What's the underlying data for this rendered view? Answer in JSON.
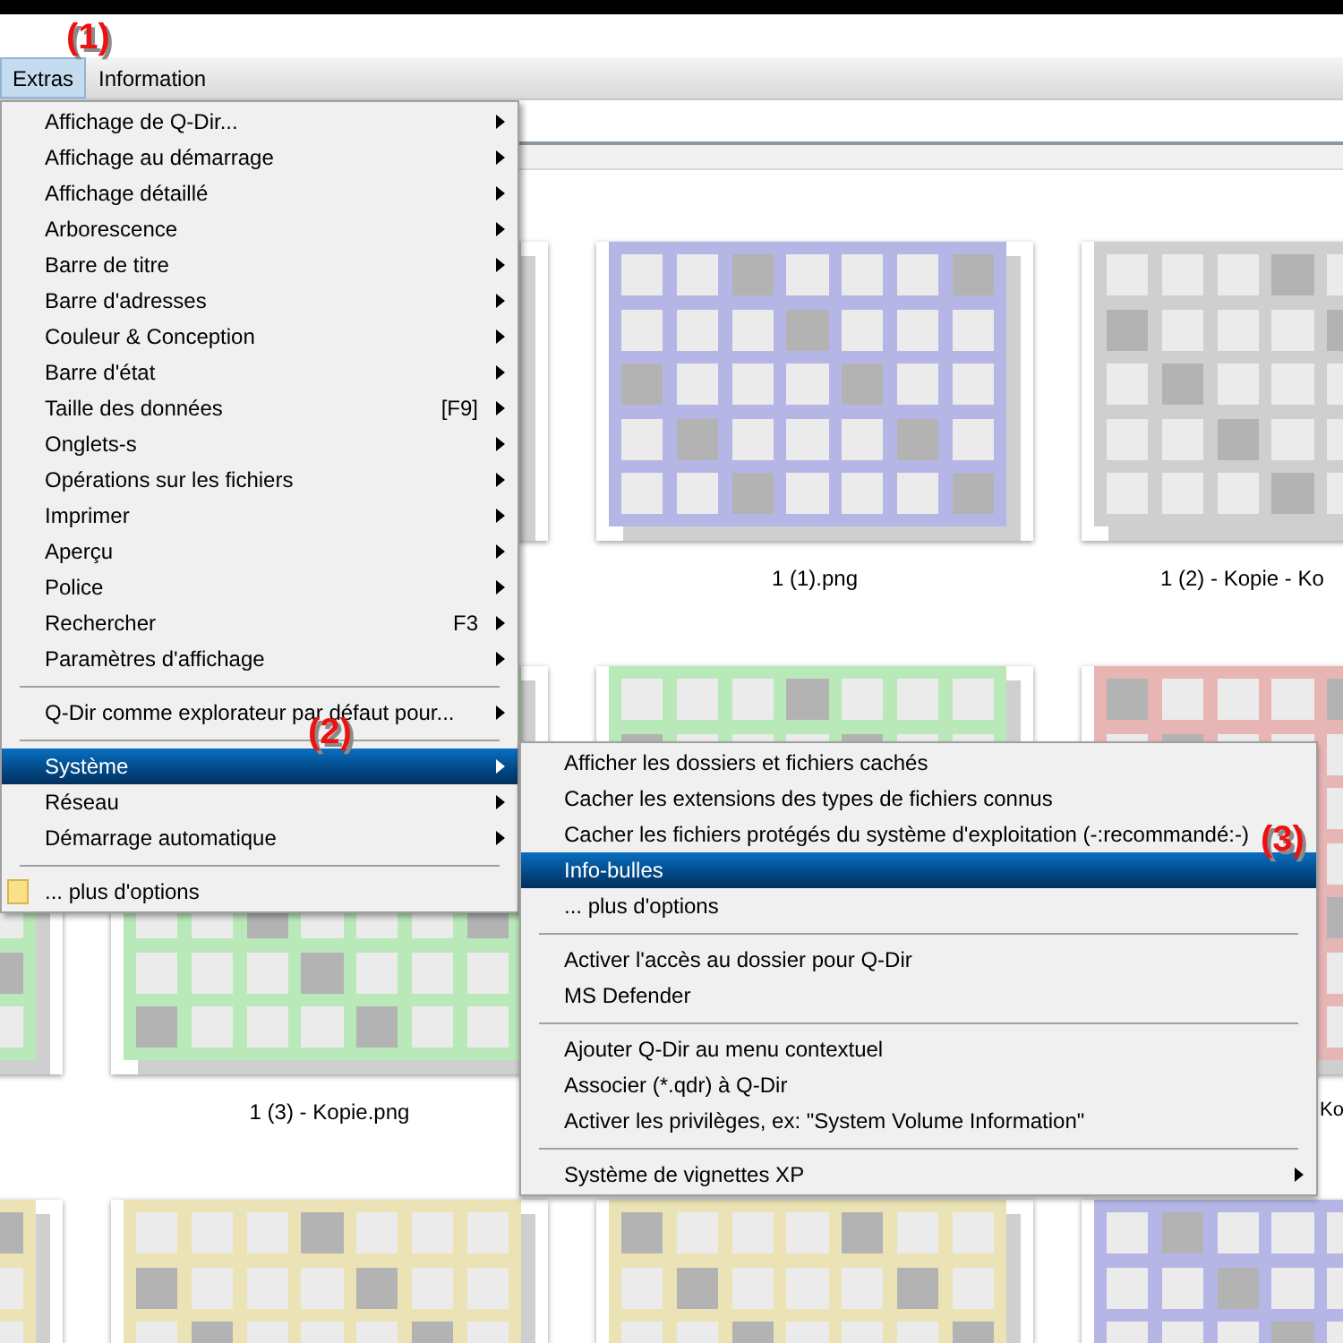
{
  "menubar": [
    {
      "label": "Extras",
      "selected": true
    },
    {
      "label": "Information",
      "selected": false
    }
  ],
  "main_menu": [
    {
      "kind": "item",
      "label": "Affichage de Q-Dir...",
      "submenu": true,
      "selected": false
    },
    {
      "kind": "item",
      "label": "Affichage au démarrage",
      "submenu": true,
      "selected": false
    },
    {
      "kind": "item",
      "label": "Affichage détaillé",
      "submenu": true,
      "selected": false
    },
    {
      "kind": "item",
      "label": "Arborescence",
      "submenu": true,
      "selected": false
    },
    {
      "kind": "item",
      "label": "Barre de titre",
      "submenu": true,
      "selected": false
    },
    {
      "kind": "item",
      "label": "Barre d'adresses",
      "submenu": true,
      "selected": false
    },
    {
      "kind": "item",
      "label": "Couleur & Conception",
      "submenu": true,
      "selected": false
    },
    {
      "kind": "item",
      "label": "Barre d'état",
      "submenu": true,
      "selected": false
    },
    {
      "kind": "item",
      "label": "Taille des données",
      "shortcut": "[F9]",
      "submenu": true,
      "selected": false
    },
    {
      "kind": "item",
      "label": "Onglets-s",
      "submenu": true,
      "selected": false
    },
    {
      "kind": "item",
      "label": "Opérations sur les fichiers",
      "submenu": true,
      "selected": false
    },
    {
      "kind": "item",
      "label": "Imprimer",
      "submenu": true,
      "selected": false
    },
    {
      "kind": "item",
      "label": "Aperçu",
      "submenu": true,
      "selected": false
    },
    {
      "kind": "item",
      "label": "Police",
      "submenu": true,
      "selected": false
    },
    {
      "kind": "item",
      "label": "Rechercher",
      "shortcut": "F3",
      "submenu": true,
      "selected": false
    },
    {
      "kind": "item",
      "label": "Paramètres d'affichage",
      "submenu": true,
      "selected": false
    },
    {
      "kind": "separator"
    },
    {
      "kind": "item",
      "label": "Q-Dir comme explorateur par défaut pour...",
      "submenu": true,
      "selected": false
    },
    {
      "kind": "separator"
    },
    {
      "kind": "item",
      "label": "Système",
      "submenu": true,
      "selected": true
    },
    {
      "kind": "item",
      "label": "Réseau",
      "submenu": true,
      "selected": false
    },
    {
      "kind": "item",
      "label": "Démarrage automatique",
      "submenu": true,
      "selected": false
    },
    {
      "kind": "separator"
    },
    {
      "kind": "folder",
      "label": "... plus d'options",
      "submenu": false,
      "selected": false
    }
  ],
  "system_submenu": [
    {
      "kind": "item",
      "label": "Afficher les dossiers et fichiers cachés",
      "submenu": false,
      "selected": false
    },
    {
      "kind": "item",
      "label": "Cacher les extensions des types de fichiers connus",
      "submenu": false,
      "selected": false
    },
    {
      "kind": "item",
      "label": "Cacher les fichiers protégés du système d'exploitation (-:recommandé:-)",
      "submenu": false,
      "selected": false
    },
    {
      "kind": "item",
      "label": "Info-bulles",
      "submenu": false,
      "selected": true
    },
    {
      "kind": "item",
      "label": "... plus d'options",
      "submenu": false,
      "selected": false
    },
    {
      "kind": "separator"
    },
    {
      "kind": "item",
      "label": "Activer l'accès au dossier pour Q-Dir",
      "submenu": false,
      "selected": false
    },
    {
      "kind": "item",
      "label": "MS Defender",
      "submenu": false,
      "selected": false
    },
    {
      "kind": "separator"
    },
    {
      "kind": "item",
      "label": "Ajouter Q-Dir au menu contextuel",
      "submenu": false,
      "selected": false
    },
    {
      "kind": "item",
      "label": "Associer (*.qdr) à Q-Dir",
      "submenu": false,
      "selected": false
    },
    {
      "kind": "item",
      "label": "Activer les privilèges, ex: \"System Volume Information\"",
      "submenu": false,
      "selected": false
    },
    {
      "kind": "separator"
    },
    {
      "kind": "item",
      "label": "Système de vignettes XP",
      "submenu": true,
      "selected": false
    }
  ],
  "thumbnail_rows": [
    {
      "thumbnails": [
        {
          "color": "#cfcfcf"
        },
        {
          "color": "#b5b5e6",
          "label": "1 (1).png"
        },
        {
          "color": "#cfcfcf",
          "label": "1 (2) - Kopie - Ko"
        }
      ]
    },
    {
      "thumbnails": [
        {
          "color": "#b9e8b9"
        },
        {
          "color": "#b9e8b9",
          "label": "1 (3) - Kopie.png"
        },
        {
          "color": "#b9e8b9"
        },
        {
          "color": "#e8b5b5",
          "label": "Ko"
        }
      ]
    },
    {
      "thumbnails": [
        {
          "color": "#ebe3b5"
        },
        {
          "color": "#ebe3b5"
        },
        {
          "color": "#ebe3b5"
        },
        {
          "color": "#b5b5e6"
        }
      ]
    }
  ],
  "annotations": [
    "(1)",
    "(2)",
    "(3)"
  ]
}
